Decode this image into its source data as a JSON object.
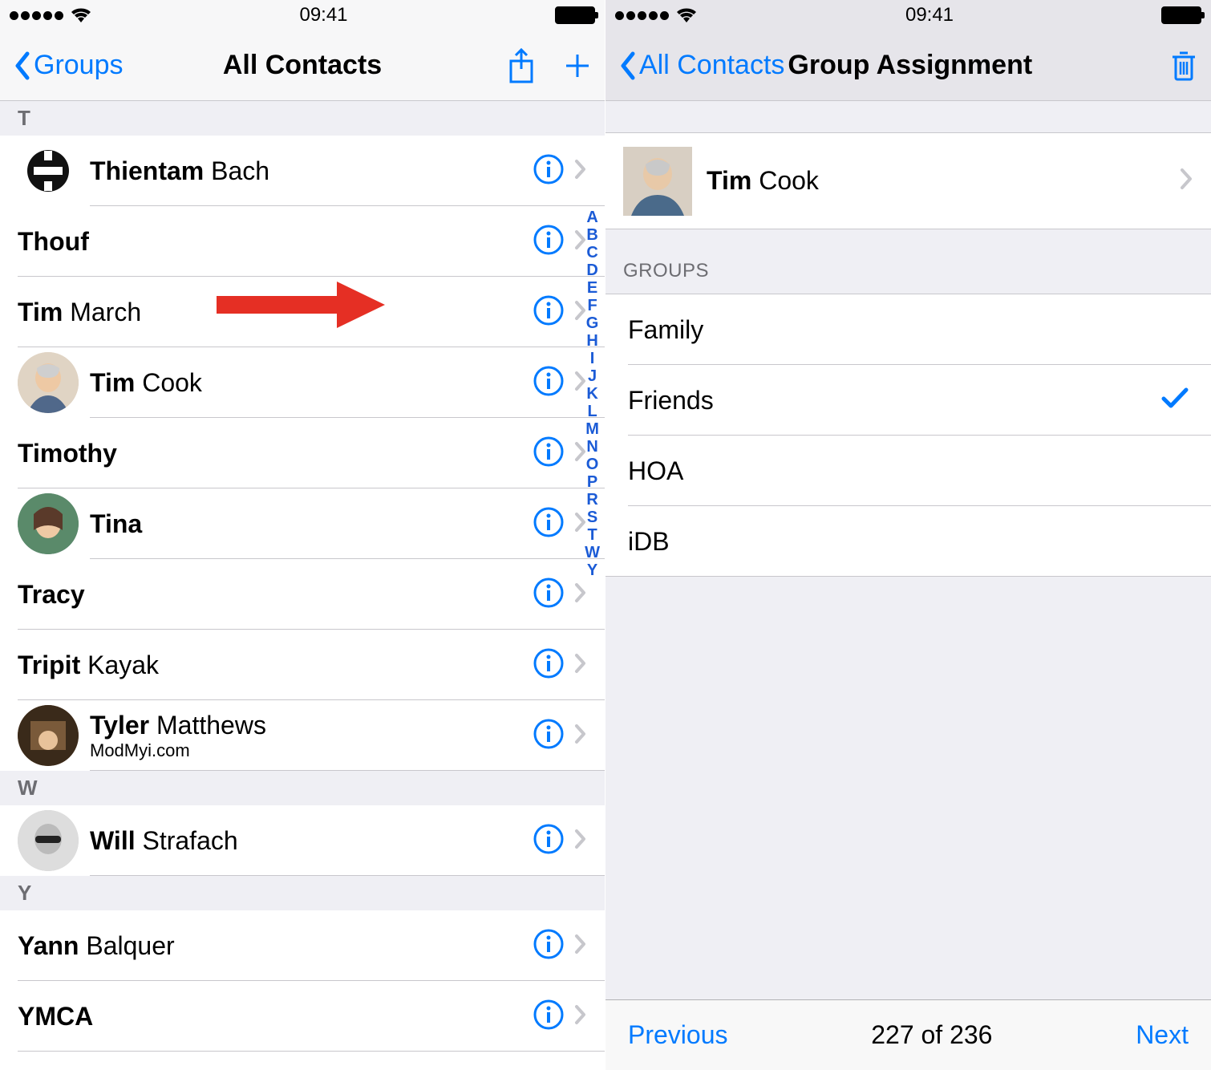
{
  "status": {
    "time": "09:41"
  },
  "left": {
    "back_label": "Groups",
    "title": "All Contacts",
    "sections": [
      {
        "letter": "T",
        "rows": [
          {
            "first": "Thientam",
            "last": "Bach",
            "avatar": "s",
            "indented": true
          },
          {
            "first": "Thouf",
            "last": ""
          },
          {
            "first": "Tim",
            "last": "March"
          },
          {
            "first": "Tim",
            "last": "Cook",
            "avatar": "tim",
            "indented": true,
            "arrow": true
          },
          {
            "first": "Timothy",
            "last": ""
          },
          {
            "first": "Tina",
            "last": "",
            "avatar": "tina",
            "indented": true
          },
          {
            "first": "Tracy",
            "last": ""
          },
          {
            "first": "Tripit",
            "last": "Kayak"
          },
          {
            "first": "Tyler",
            "last": "Matthews",
            "sub": "ModMyi.com",
            "avatar": "tyler",
            "indented": true
          }
        ]
      },
      {
        "letter": "W",
        "rows": [
          {
            "first": "Will",
            "last": "Strafach",
            "avatar": "will",
            "indented": true
          }
        ]
      },
      {
        "letter": "Y",
        "rows": [
          {
            "first": "Yann",
            "last": "Balquer"
          },
          {
            "first": "YMCA",
            "last": ""
          }
        ]
      }
    ],
    "index": [
      "A",
      "B",
      "C",
      "D",
      "E",
      "F",
      "G",
      "H",
      "I",
      "J",
      "K",
      "L",
      "M",
      "N",
      "O",
      "P",
      "R",
      "S",
      "T",
      "W",
      "Y"
    ]
  },
  "right": {
    "back_label": "All Contacts",
    "title": "Group Assignment",
    "contact": {
      "first": "Tim",
      "last": "Cook"
    },
    "groups_header": "Groups",
    "groups": [
      {
        "name": "Family",
        "checked": false
      },
      {
        "name": "Friends",
        "checked": true
      },
      {
        "name": "HOA",
        "checked": false
      },
      {
        "name": "iDB",
        "checked": false
      }
    ],
    "toolbar": {
      "prev": "Previous",
      "count": "227 of 236",
      "next": "Next"
    }
  }
}
